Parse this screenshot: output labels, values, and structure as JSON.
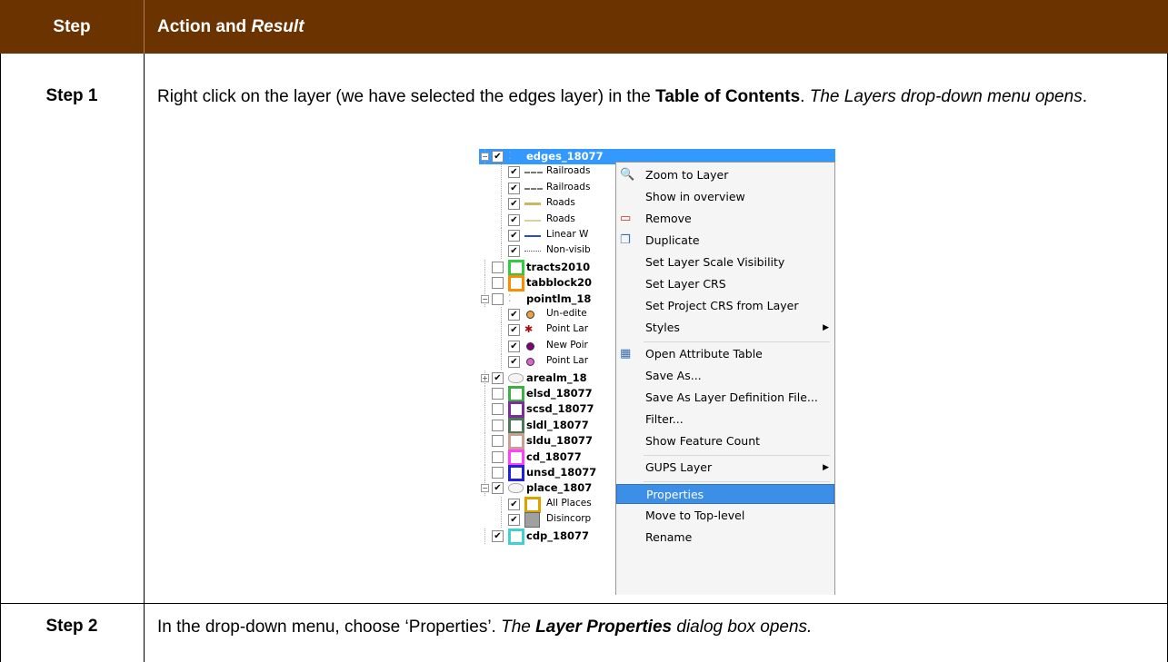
{
  "header": {
    "col1": "Step",
    "col2_plain": "Action and ",
    "col2_italic": "Result"
  },
  "rows": [
    {
      "step": "Step 1",
      "parts": [
        {
          "t": "Right click on the layer (we have selected the edges layer) in the ",
          "s": "n"
        },
        {
          "t": "Table of Contents",
          "s": "b"
        },
        {
          "t": ". ",
          "s": "n"
        },
        {
          "t": "The Layers drop-down menu opens",
          "s": "i"
        },
        {
          "t": ".",
          "s": "n"
        }
      ]
    },
    {
      "step": "Step 2",
      "parts": [
        {
          "t": "In the drop-down menu, choose ‘Properties’. ",
          "s": "n"
        },
        {
          "t": "The ",
          "s": "i"
        },
        {
          "t": "Layer Properties",
          "s": "bi"
        },
        {
          "t": " dialog box opens.",
          "s": "i"
        }
      ]
    }
  ],
  "screenshot": {
    "tree": [
      {
        "name": "edges_18077",
        "level": 0,
        "checked": true,
        "expander": "−",
        "bold": true,
        "selected": true,
        "sym": "dots"
      },
      {
        "name": "Railroads",
        "level": 1,
        "checked": true,
        "sym": "rail"
      },
      {
        "name": "Railroads",
        "level": 1,
        "checked": true,
        "sym": "rail2"
      },
      {
        "name": "Roads",
        "level": 1,
        "checked": true,
        "sym": "road"
      },
      {
        "name": "Roads",
        "level": 1,
        "checked": true,
        "sym": "road2"
      },
      {
        "name": "Linear W",
        "level": 1,
        "checked": true,
        "sym": "water"
      },
      {
        "name": "Non-visib",
        "level": 1,
        "checked": true,
        "sym": "dash"
      },
      {
        "name": "tracts2010",
        "level": 0,
        "checked": false,
        "bold": true,
        "sym": "box",
        "color": "#2ecc40"
      },
      {
        "name": "tabblock20",
        "level": 0,
        "checked": false,
        "bold": true,
        "sym": "box",
        "color": "#ff8c00"
      },
      {
        "name": "pointlm_18",
        "level": 0,
        "checked": false,
        "expander": "−",
        "bold": true,
        "sym": "dots"
      },
      {
        "name": "Un-edite",
        "level": 1,
        "checked": true,
        "sym": "circle",
        "color": "#f0a040"
      },
      {
        "name": "Point Lar",
        "level": 1,
        "checked": true,
        "sym": "star",
        "color": "#a01010"
      },
      {
        "name": "New Poir",
        "level": 1,
        "checked": true,
        "sym": "circle",
        "color": "#800080"
      },
      {
        "name": "Point Lar",
        "level": 1,
        "checked": true,
        "sym": "circle",
        "color": "#e060d0"
      },
      {
        "name": "arealm_18",
        "level": 0,
        "checked": true,
        "expander": "+",
        "bold": true,
        "sym": "blob"
      },
      {
        "name": "elsd_18077",
        "level": 0,
        "checked": false,
        "bold": true,
        "sym": "box",
        "color": "#3cb043"
      },
      {
        "name": "scsd_18077",
        "level": 0,
        "checked": false,
        "bold": true,
        "sym": "box",
        "color": "#7b2d9e"
      },
      {
        "name": "sldl_18077",
        "level": 0,
        "checked": false,
        "bold": true,
        "sym": "box",
        "color": "#4a7a5a"
      },
      {
        "name": "sldu_18077",
        "level": 0,
        "checked": false,
        "bold": true,
        "sym": "box",
        "color": "#c8a090"
      },
      {
        "name": "cd_18077",
        "level": 0,
        "checked": false,
        "bold": true,
        "sym": "box",
        "color": "#ff40ff"
      },
      {
        "name": "unsd_18077",
        "level": 0,
        "checked": false,
        "bold": true,
        "sym": "box",
        "color": "#2020e0"
      },
      {
        "name": "place_1807",
        "level": 0,
        "checked": true,
        "expander": "−",
        "bold": true,
        "sym": "blob"
      },
      {
        "name": "All Places",
        "level": 1,
        "checked": true,
        "sym": "box",
        "color": "#e0a000"
      },
      {
        "name": "Disincorp",
        "level": 1,
        "checked": true,
        "sym": "fill",
        "color": "#a0a0a0"
      },
      {
        "name": "cdp_18077",
        "level": 0,
        "checked": true,
        "bold": true,
        "sym": "box",
        "color": "#40d0d0"
      }
    ],
    "menu": [
      {
        "label": "Zoom to Layer",
        "icon": "zoom-icon"
      },
      {
        "label": "Show in overview"
      },
      {
        "label": "Remove",
        "icon": "remove-icon"
      },
      {
        "label": "Duplicate",
        "icon": "duplicate-icon"
      },
      {
        "label": "Set Layer Scale Visibility"
      },
      {
        "label": "Set Layer CRS"
      },
      {
        "label": "Set Project CRS from Layer"
      },
      {
        "label": "Styles",
        "submenu": true
      },
      {
        "sep": true
      },
      {
        "label": "Open Attribute Table",
        "icon": "table-icon"
      },
      {
        "label": "Save As..."
      },
      {
        "label": "Save As Layer Definition File..."
      },
      {
        "label": "Filter..."
      },
      {
        "label": "Show Feature Count"
      },
      {
        "sep": true
      },
      {
        "label": "GUPS Layer",
        "submenu": true
      },
      {
        "sep": true
      },
      {
        "label": "Properties",
        "highlighted": true
      },
      {
        "label": "Move to Top-level"
      },
      {
        "label": "Rename"
      }
    ]
  }
}
